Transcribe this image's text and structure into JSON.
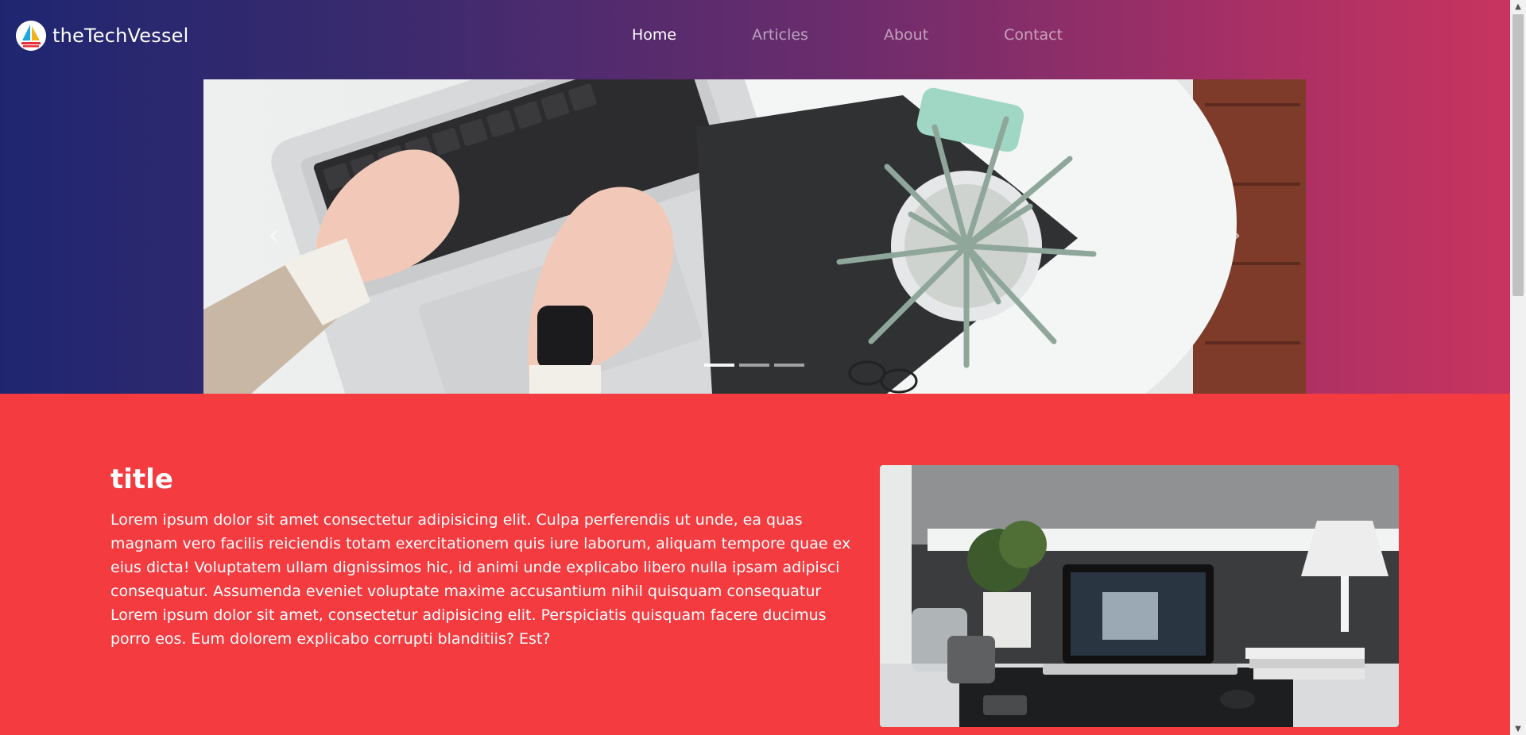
{
  "brand": {
    "name": "theTechVessel",
    "logo_icon": "sailboat-icon"
  },
  "nav": {
    "items": [
      {
        "label": "Home",
        "active": true
      },
      {
        "label": "Articles",
        "active": false
      },
      {
        "label": "About",
        "active": false
      },
      {
        "label": "Contact",
        "active": false
      }
    ]
  },
  "carousel": {
    "prev_icon": "chevron-left-icon",
    "next_icon": "chevron-right-icon",
    "prev_glyph": "‹",
    "next_glyph": "›",
    "slide_count": 3,
    "active_slide": 1
  },
  "section": {
    "title": "title",
    "body": "Lorem ipsum dolor sit amet consectetur adipisicing elit. Culpa perferendis ut unde, ea quas magnam vero facilis reiciendis totam exercitationem quis iure laborum, aliquam tempore quae ex eius dicta! Voluptatem ullam dignissimos hic, id animi unde explicabo libero nulla ipsam adipisci consequatur. Assumenda eveniet voluptate maxime accusantium nihil quisquam consequatur Lorem ipsum dolor sit amet, consectetur adipisicing elit. Perspiciatis quisquam facere ducimus porro eos. Eum dolorem explicabo corrupti blanditiis? Est?"
  },
  "colors": {
    "gradient_start": "#1f2670",
    "gradient_end": "#c8345f",
    "section_bg": "#f33b40",
    "text": "#ffffff"
  }
}
